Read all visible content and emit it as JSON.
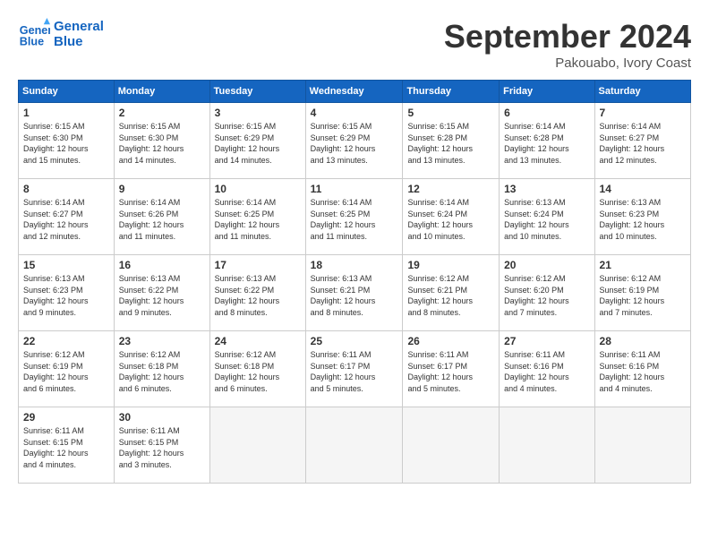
{
  "header": {
    "logo_line1": "General",
    "logo_line2": "Blue",
    "month": "September 2024",
    "location": "Pakouabo, Ivory Coast"
  },
  "weekdays": [
    "Sunday",
    "Monday",
    "Tuesday",
    "Wednesday",
    "Thursday",
    "Friday",
    "Saturday"
  ],
  "weeks": [
    [
      {
        "day": "1",
        "info": "Sunrise: 6:15 AM\nSunset: 6:30 PM\nDaylight: 12 hours\nand 15 minutes."
      },
      {
        "day": "2",
        "info": "Sunrise: 6:15 AM\nSunset: 6:30 PM\nDaylight: 12 hours\nand 14 minutes."
      },
      {
        "day": "3",
        "info": "Sunrise: 6:15 AM\nSunset: 6:29 PM\nDaylight: 12 hours\nand 14 minutes."
      },
      {
        "day": "4",
        "info": "Sunrise: 6:15 AM\nSunset: 6:29 PM\nDaylight: 12 hours\nand 13 minutes."
      },
      {
        "day": "5",
        "info": "Sunrise: 6:15 AM\nSunset: 6:28 PM\nDaylight: 12 hours\nand 13 minutes."
      },
      {
        "day": "6",
        "info": "Sunrise: 6:14 AM\nSunset: 6:28 PM\nDaylight: 12 hours\nand 13 minutes."
      },
      {
        "day": "7",
        "info": "Sunrise: 6:14 AM\nSunset: 6:27 PM\nDaylight: 12 hours\nand 12 minutes."
      }
    ],
    [
      {
        "day": "8",
        "info": "Sunrise: 6:14 AM\nSunset: 6:27 PM\nDaylight: 12 hours\nand 12 minutes."
      },
      {
        "day": "9",
        "info": "Sunrise: 6:14 AM\nSunset: 6:26 PM\nDaylight: 12 hours\nand 11 minutes."
      },
      {
        "day": "10",
        "info": "Sunrise: 6:14 AM\nSunset: 6:25 PM\nDaylight: 12 hours\nand 11 minutes."
      },
      {
        "day": "11",
        "info": "Sunrise: 6:14 AM\nSunset: 6:25 PM\nDaylight: 12 hours\nand 11 minutes."
      },
      {
        "day": "12",
        "info": "Sunrise: 6:14 AM\nSunset: 6:24 PM\nDaylight: 12 hours\nand 10 minutes."
      },
      {
        "day": "13",
        "info": "Sunrise: 6:13 AM\nSunset: 6:24 PM\nDaylight: 12 hours\nand 10 minutes."
      },
      {
        "day": "14",
        "info": "Sunrise: 6:13 AM\nSunset: 6:23 PM\nDaylight: 12 hours\nand 10 minutes."
      }
    ],
    [
      {
        "day": "15",
        "info": "Sunrise: 6:13 AM\nSunset: 6:23 PM\nDaylight: 12 hours\nand 9 minutes."
      },
      {
        "day": "16",
        "info": "Sunrise: 6:13 AM\nSunset: 6:22 PM\nDaylight: 12 hours\nand 9 minutes."
      },
      {
        "day": "17",
        "info": "Sunrise: 6:13 AM\nSunset: 6:22 PM\nDaylight: 12 hours\nand 8 minutes."
      },
      {
        "day": "18",
        "info": "Sunrise: 6:13 AM\nSunset: 6:21 PM\nDaylight: 12 hours\nand 8 minutes."
      },
      {
        "day": "19",
        "info": "Sunrise: 6:12 AM\nSunset: 6:21 PM\nDaylight: 12 hours\nand 8 minutes."
      },
      {
        "day": "20",
        "info": "Sunrise: 6:12 AM\nSunset: 6:20 PM\nDaylight: 12 hours\nand 7 minutes."
      },
      {
        "day": "21",
        "info": "Sunrise: 6:12 AM\nSunset: 6:19 PM\nDaylight: 12 hours\nand 7 minutes."
      }
    ],
    [
      {
        "day": "22",
        "info": "Sunrise: 6:12 AM\nSunset: 6:19 PM\nDaylight: 12 hours\nand 6 minutes."
      },
      {
        "day": "23",
        "info": "Sunrise: 6:12 AM\nSunset: 6:18 PM\nDaylight: 12 hours\nand 6 minutes."
      },
      {
        "day": "24",
        "info": "Sunrise: 6:12 AM\nSunset: 6:18 PM\nDaylight: 12 hours\nand 6 minutes."
      },
      {
        "day": "25",
        "info": "Sunrise: 6:11 AM\nSunset: 6:17 PM\nDaylight: 12 hours\nand 5 minutes."
      },
      {
        "day": "26",
        "info": "Sunrise: 6:11 AM\nSunset: 6:17 PM\nDaylight: 12 hours\nand 5 minutes."
      },
      {
        "day": "27",
        "info": "Sunrise: 6:11 AM\nSunset: 6:16 PM\nDaylight: 12 hours\nand 4 minutes."
      },
      {
        "day": "28",
        "info": "Sunrise: 6:11 AM\nSunset: 6:16 PM\nDaylight: 12 hours\nand 4 minutes."
      }
    ],
    [
      {
        "day": "29",
        "info": "Sunrise: 6:11 AM\nSunset: 6:15 PM\nDaylight: 12 hours\nand 4 minutes."
      },
      {
        "day": "30",
        "info": "Sunrise: 6:11 AM\nSunset: 6:15 PM\nDaylight: 12 hours\nand 3 minutes."
      },
      {
        "day": "",
        "info": ""
      },
      {
        "day": "",
        "info": ""
      },
      {
        "day": "",
        "info": ""
      },
      {
        "day": "",
        "info": ""
      },
      {
        "day": "",
        "info": ""
      }
    ]
  ]
}
